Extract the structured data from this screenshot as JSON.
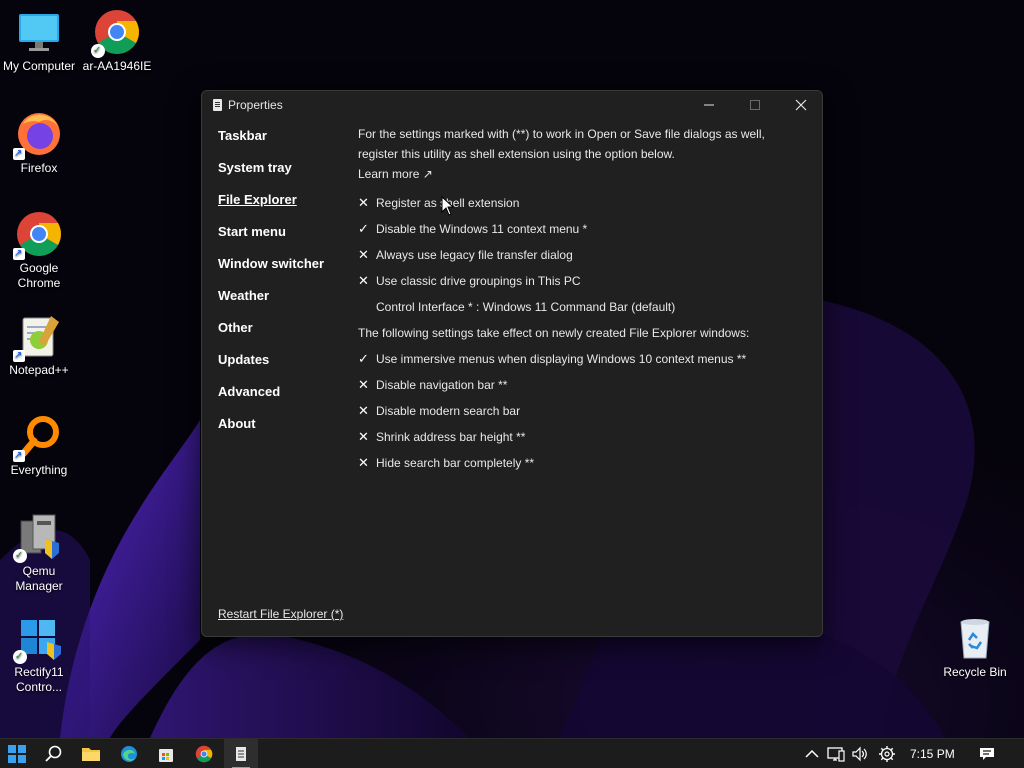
{
  "desktop": {
    "icons": [
      {
        "label": "My Computer",
        "icon": "monitor-icon"
      },
      {
        "label": "ar-AA1946IE",
        "icon": "chrome-icon"
      },
      {
        "label": "Firefox",
        "icon": "firefox-icon"
      },
      {
        "label": "Google Chrome",
        "icon": "chrome-icon"
      },
      {
        "label": "Notepad++",
        "icon": "notepad-plus-plus-icon"
      },
      {
        "label": "Everything",
        "icon": "search-icon"
      },
      {
        "label": "Qemu Manager",
        "icon": "qemu-manager-icon"
      },
      {
        "label": "Rectify11 Contro...",
        "icon": "windows-icon"
      },
      {
        "label": "Recycle Bin",
        "icon": "recycle-bin-icon"
      }
    ]
  },
  "window": {
    "title": "Properties",
    "nav": [
      "Taskbar",
      "System tray",
      "File Explorer",
      "Start menu",
      "Window switcher",
      "Weather",
      "Other",
      "Updates",
      "Advanced",
      "About"
    ],
    "active_nav": "File Explorer",
    "intro": "For the settings marked with (**) to work in Open or Save file dialogs as well, register this utility as shell extension using the option below.",
    "learn_more": "Learn more ↗",
    "options_a": [
      {
        "mark": "✕",
        "label": "Register as shell extension"
      },
      {
        "mark": "✓",
        "label": "Disable the Windows 11 context menu *"
      },
      {
        "mark": "✕",
        "label": "Always use legacy file transfer dialog"
      },
      {
        "mark": "✕",
        "label": "Use classic drive groupings in This PC"
      },
      {
        "mark": "",
        "label": "Control Interface * : Windows 11 Command Bar (default)"
      }
    ],
    "section_label": "The following settings take effect on newly created File Explorer windows:",
    "options_b": [
      {
        "mark": "✓",
        "label": "Use immersive menus when displaying Windows 10 context menus **"
      },
      {
        "mark": "✕",
        "label": "Disable navigation bar **"
      },
      {
        "mark": "✕",
        "label": "Disable modern search bar"
      },
      {
        "mark": "✕",
        "label": "Shrink address bar height **"
      },
      {
        "mark": "✕",
        "label": "Hide search bar completely **"
      }
    ],
    "restart_link": "Restart File Explorer (*)"
  },
  "taskbar": {
    "pinned": [
      "start-icon",
      "search-icon",
      "file-explorer-icon",
      "edge-icon",
      "store-icon",
      "chrome-icon",
      "properties-app-icon"
    ],
    "tray": [
      "chevron-up-icon",
      "network-icon",
      "volume-icon",
      "settings-icon"
    ],
    "clock": "7:15 PM",
    "notification": "notification-icon"
  },
  "colors": {
    "window_bg": "#202020",
    "taskbar_bg": "#1c1c1c",
    "active_indicator": "#c27be0"
  }
}
